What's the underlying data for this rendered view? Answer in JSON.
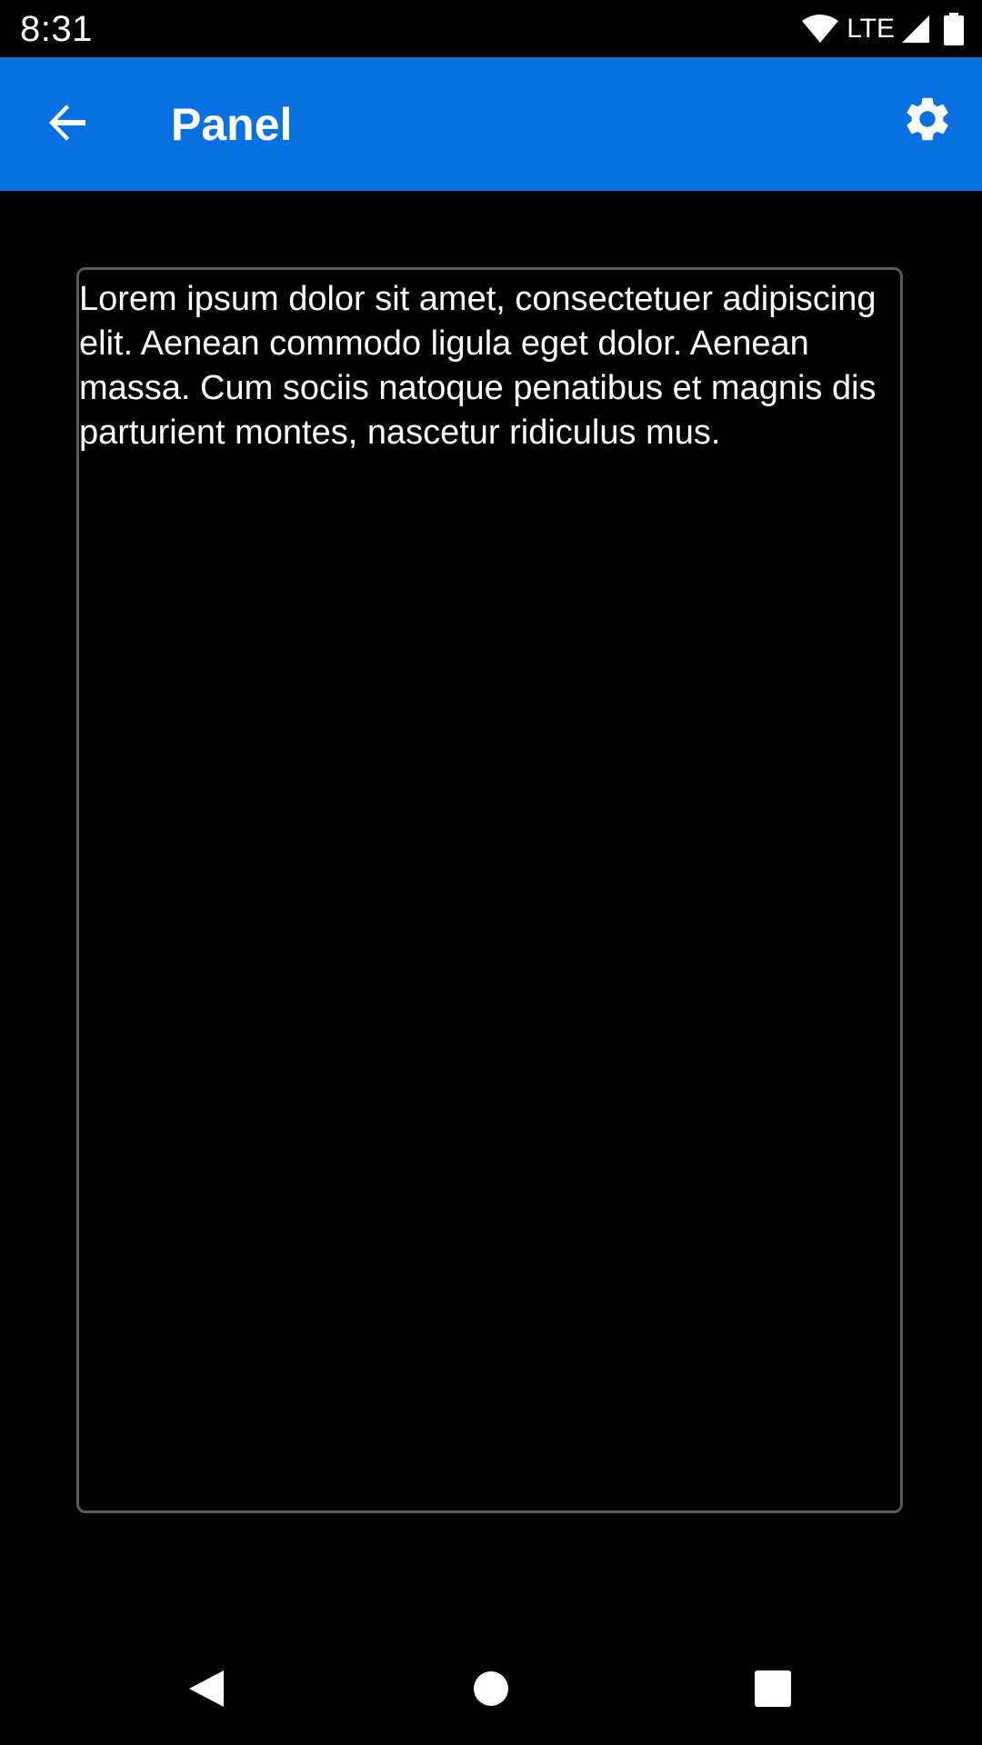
{
  "status_bar": {
    "time": "8:31",
    "network_label": "LTE",
    "icons": [
      "wifi-icon",
      "cell-signal-icon",
      "battery-icon"
    ]
  },
  "app_bar": {
    "title": "Panel",
    "back_icon": "arrow-back-icon",
    "settings_icon": "gear-icon",
    "background_color": "#0870e0"
  },
  "panel": {
    "text": "Lorem ipsum dolor sit amet, consectetuer adipiscing elit. Aenean commodo ligula eget dolor. Aenean massa. Cum sociis natoque penatibus et magnis dis parturient montes, nascetur ridiculus mus.",
    "border_color": "#5a5a5a"
  },
  "nav_bar": {
    "buttons": [
      "nav-back-icon",
      "nav-home-icon",
      "nav-recents-icon"
    ]
  }
}
